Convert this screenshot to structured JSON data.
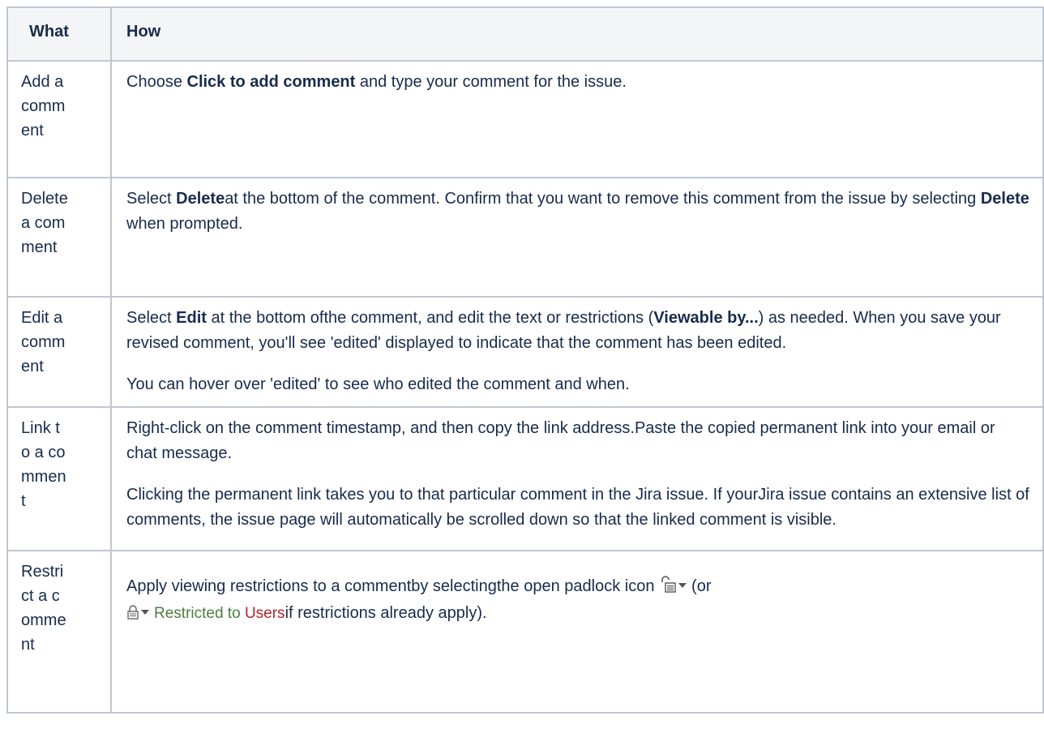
{
  "header": {
    "what": "What",
    "how": "How"
  },
  "rows": [
    {
      "what": "Add a comment",
      "how": {
        "p1": [
          "Choose ",
          "Click to add comment",
          " and type your comment for the issue."
        ]
      }
    },
    {
      "what": "Delete a comment",
      "how": {
        "p1": [
          "Select ",
          "Delete",
          "at the bottom of the comment. Confirm that you want to remove this comment from the issue by selecting ",
          "Delete",
          " when prompted."
        ]
      }
    },
    {
      "what": "Edit a comment",
      "how": {
        "p1": [
          "Select ",
          "Edit",
          " at the bottom ofthe comment, and edit the text or restrictions (",
          "Viewable by...",
          ") as needed. When you save your revised comment, you'll see 'edited' displayed to indicate that the comment has been edited."
        ],
        "p2": "You can hover over 'edited' to see who edited the comment and when."
      }
    },
    {
      "what": "Link to a comment",
      "how": {
        "p1": "Right-click on the comment timestamp, and then copy the link address.Paste the copied permanent link into your email or chat message.",
        "p2": "Clicking the permanent link takes you to that particular comment in the Jira issue. If yourJira issue contains an extensive list of comments, the issue page will automatically be scrolled down so that the linked comment is visible."
      }
    },
    {
      "what": "Restrict a comment",
      "how": {
        "p1a": "Apply viewing restrictions to a commentby selectingthe open padlock icon",
        "p1b": "(or",
        "restricted_to": "Restricted to ",
        "restricted_users": "Users",
        "p1c": "if restrictions already apply)."
      }
    }
  ],
  "icons": {
    "open_padlock": "open-padlock-icon",
    "closed_padlock": "closed-padlock-icon",
    "dropdown_caret": "caret-down-icon"
  },
  "colors": {
    "border": "#c1c7d0",
    "header_bg": "#f4f5f7",
    "text": "#172b4d",
    "restricted_green": "#4a7f3c",
    "restricted_red": "#b0232a"
  }
}
